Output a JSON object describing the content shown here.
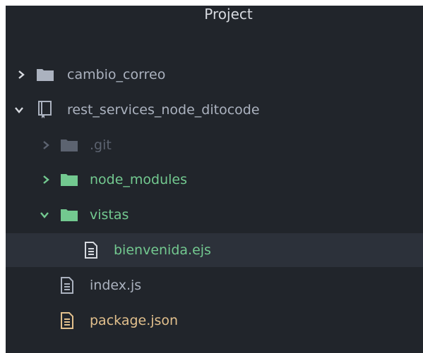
{
  "panel": {
    "title": "Project"
  },
  "tree": {
    "items": [
      {
        "label": "cambio_correo",
        "icon": "folder-icon",
        "expanded": false,
        "color": "#abb2bf"
      },
      {
        "label": "rest_services_node_ditocode",
        "icon": "repo-icon",
        "expanded": true,
        "color": "#abb2bf"
      },
      {
        "label": ".git",
        "icon": "folder-icon",
        "expanded": false,
        "color": "#5c6370"
      },
      {
        "label": "node_modules",
        "icon": "folder-icon",
        "expanded": false,
        "color": "#73c990"
      },
      {
        "label": "vistas",
        "icon": "folder-icon",
        "expanded": true,
        "color": "#73c990"
      },
      {
        "label": "bienvenida.ejs",
        "icon": "file-text-icon",
        "selected": true,
        "color": "#73c990"
      },
      {
        "label": "index.js",
        "icon": "file-text-icon",
        "color": "#abb2bf"
      },
      {
        "label": "package.json",
        "icon": "file-text-icon",
        "color": "#e2c08d"
      }
    ]
  },
  "colors": {
    "background": "#21252b",
    "selected_row": "#2c313a",
    "text": "#abb2bf",
    "ignored": "#5c6370",
    "added": "#73c990",
    "modified": "#e2c08d"
  }
}
